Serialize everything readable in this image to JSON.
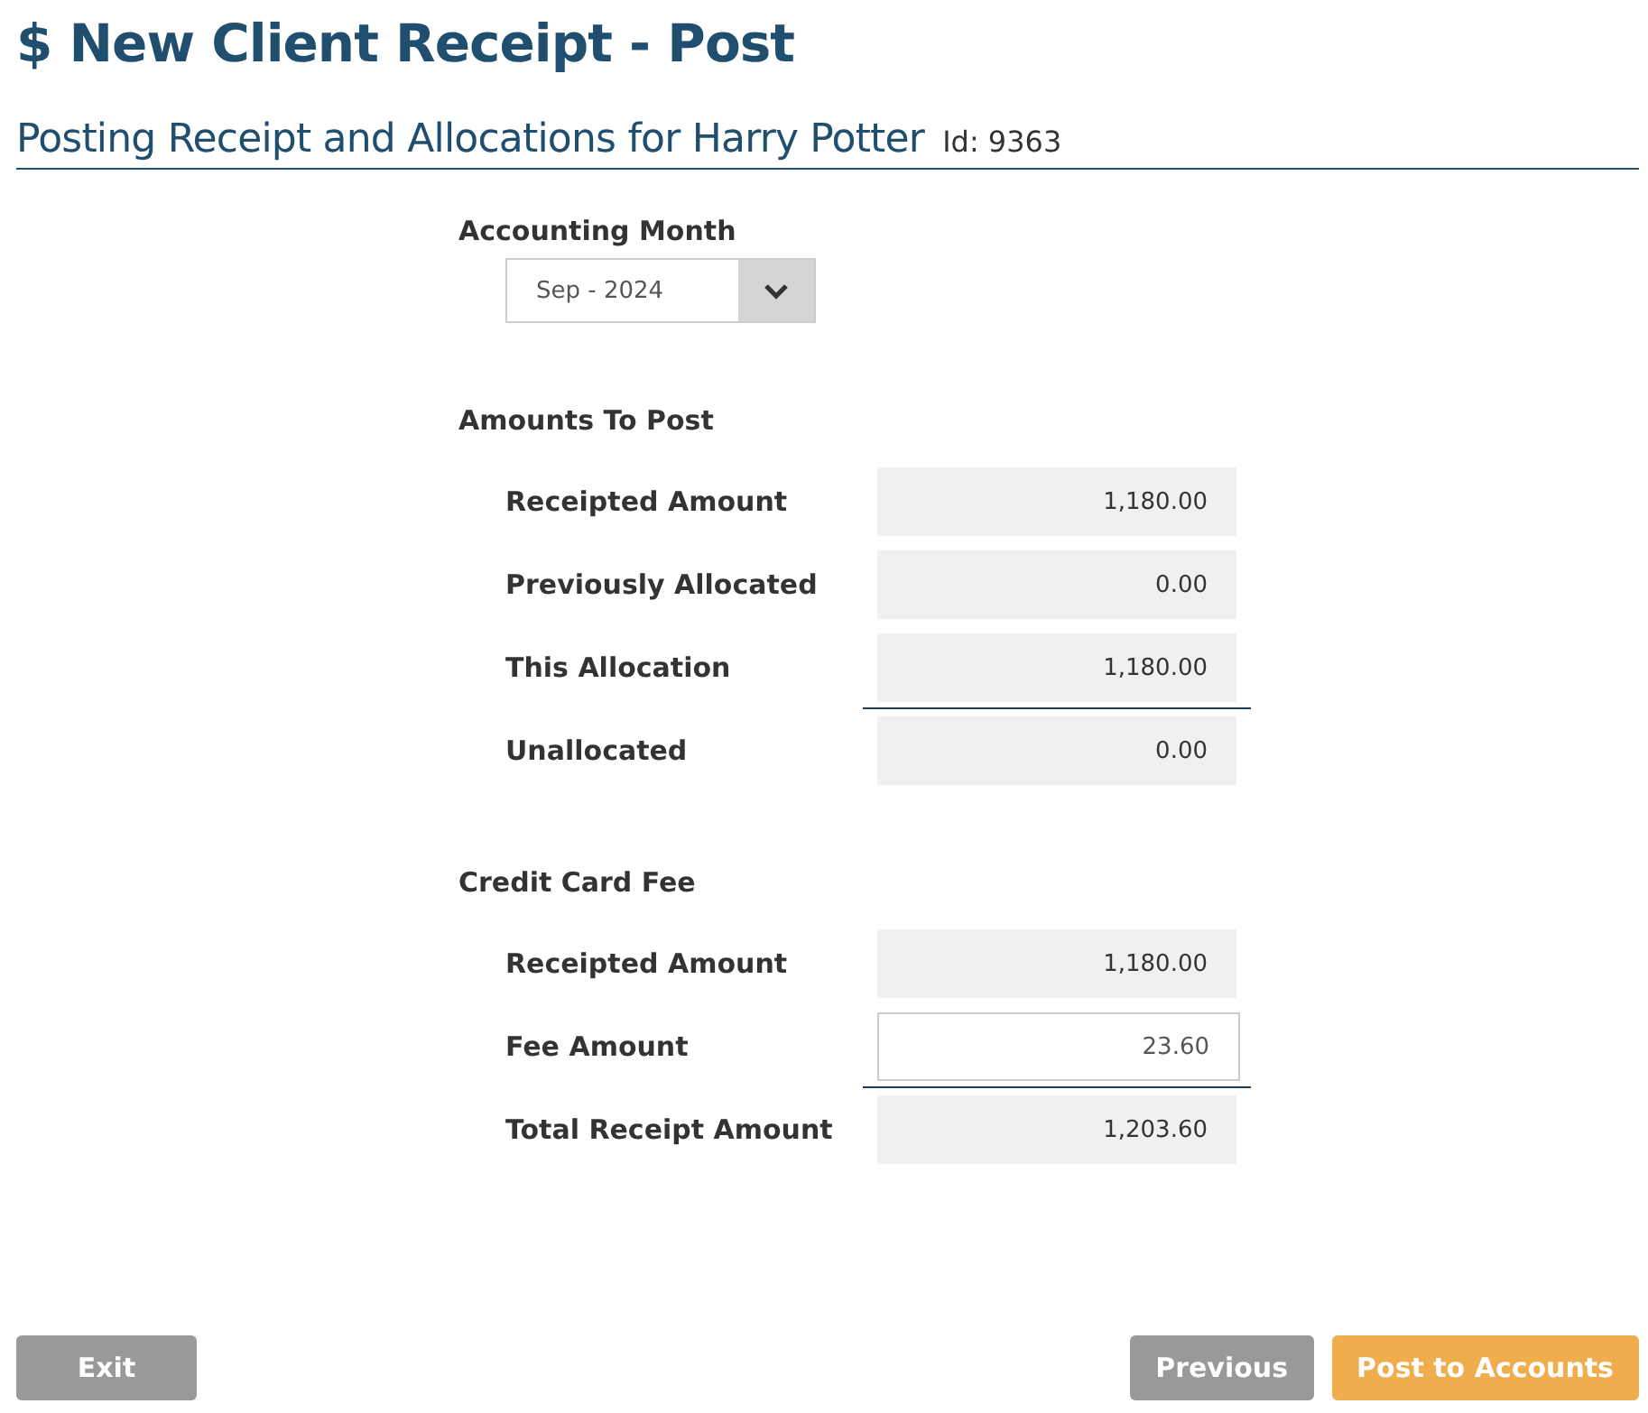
{
  "page": {
    "title": "$ New Client Receipt - Post",
    "subtitle": "Posting Receipt and Allocations for Harry Potter",
    "id_text": "Id: 9363"
  },
  "accounting_month": {
    "label": "Accounting Month",
    "value": "Sep - 2024"
  },
  "sections": [
    {
      "title": "Amounts To Post",
      "rows": [
        {
          "label": "Receipted Amount",
          "value": "1,180.00",
          "kind": "readonly",
          "rule_above": false
        },
        {
          "label": "Previously Allocated",
          "value": "0.00",
          "kind": "readonly",
          "rule_above": false
        },
        {
          "label": "This Allocation",
          "value": "1,180.00",
          "kind": "readonly",
          "rule_above": false
        },
        {
          "label": "Unallocated",
          "value": "0.00",
          "kind": "readonly",
          "rule_above": true
        }
      ]
    },
    {
      "title": "Credit Card Fee",
      "rows": [
        {
          "label": "Receipted Amount",
          "value": "1,180.00",
          "kind": "readonly",
          "rule_above": false
        },
        {
          "label": "Fee Amount",
          "value": "23.60",
          "kind": "input",
          "rule_above": false
        },
        {
          "label": "Total Receipt Amount",
          "value": "1,203.60",
          "kind": "readonly",
          "rule_above": true
        }
      ]
    }
  ],
  "footer": {
    "left_buttons": [
      {
        "label": "Exit",
        "kind": "neutral"
      }
    ],
    "right_buttons": [
      {
        "label": "Previous",
        "kind": "neutral"
      },
      {
        "label": "Post to Accounts",
        "kind": "primary"
      }
    ]
  }
}
